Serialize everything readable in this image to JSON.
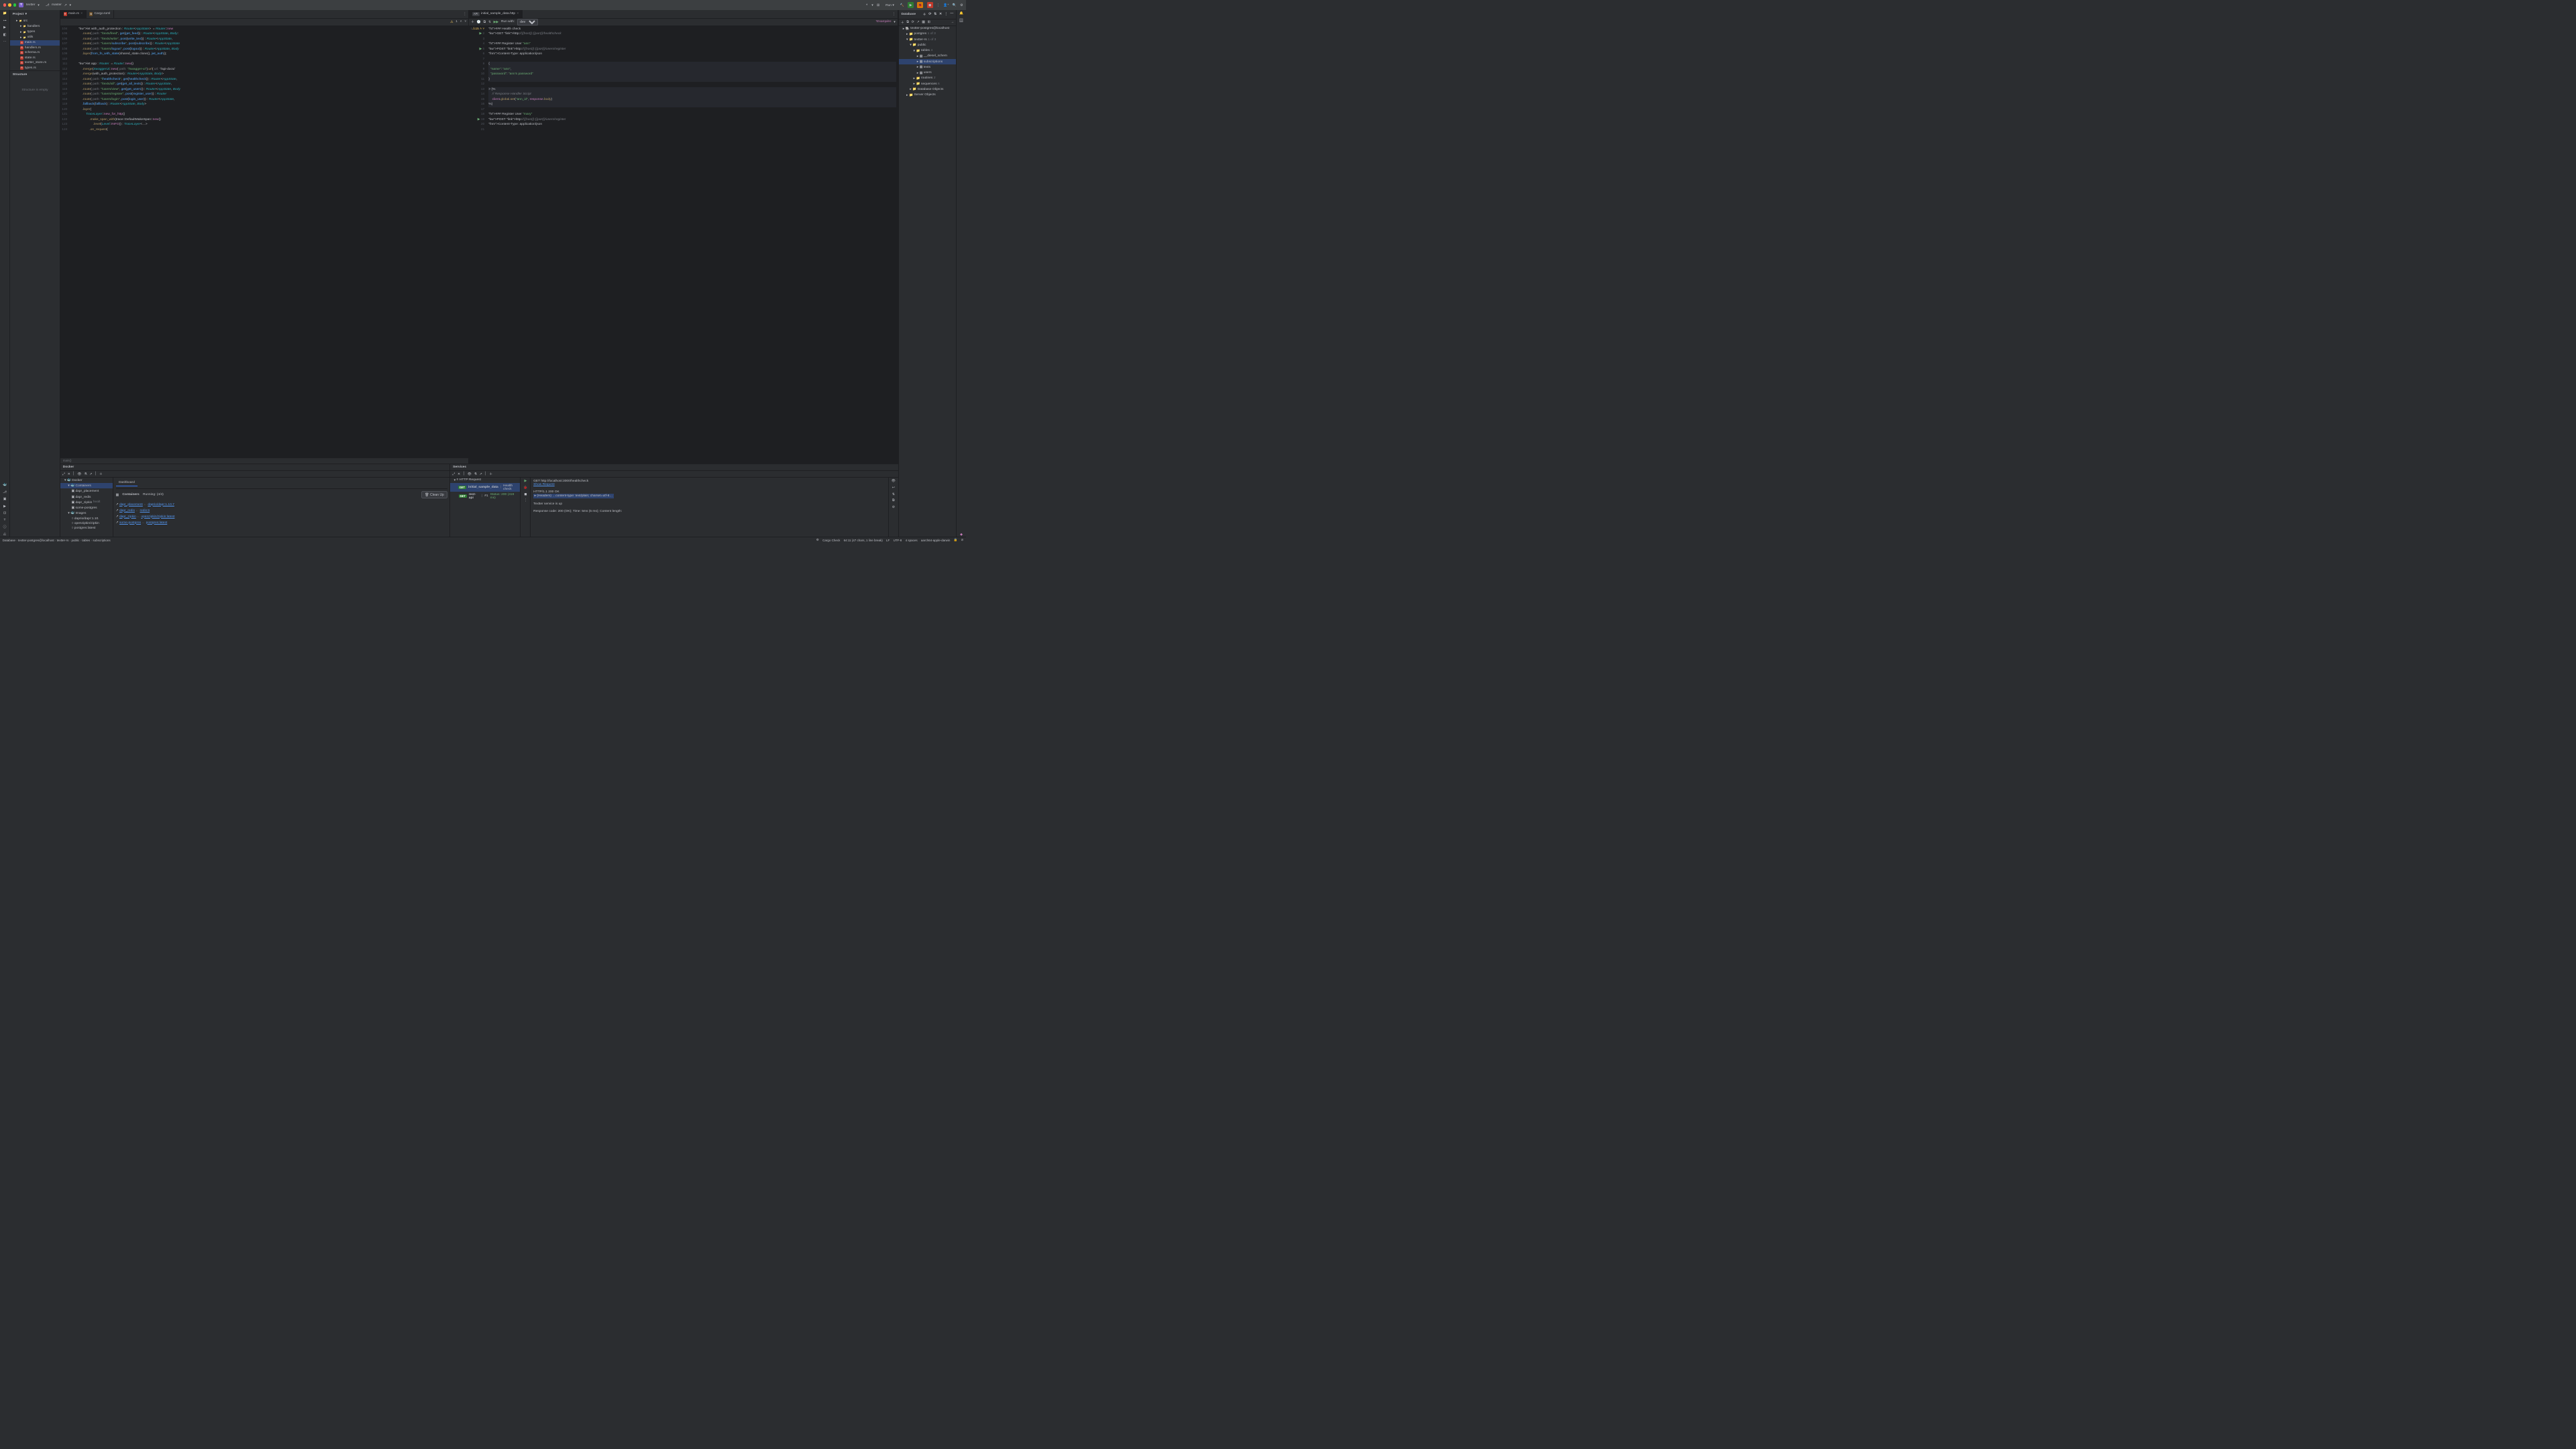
{
  "titlebar": {
    "project_badge": "T",
    "project_name": "textter",
    "branch": "master",
    "run_label": "Run"
  },
  "project_panel": {
    "title": "Project",
    "items": [
      {
        "label": "src",
        "icon": "dir",
        "indent": 0,
        "expanded": true
      },
      {
        "label": "handlers",
        "icon": "dir",
        "indent": 1
      },
      {
        "label": "types",
        "icon": "dir",
        "indent": 1
      },
      {
        "label": "utils",
        "icon": "dir",
        "indent": 1
      },
      {
        "label": "main.rs",
        "icon": "rs",
        "indent": 1,
        "selected": true
      },
      {
        "label": "handlers.rs",
        "icon": "rs",
        "indent": 1
      },
      {
        "label": "schema.rs",
        "icon": "rs",
        "indent": 1
      },
      {
        "label": "state.rs",
        "icon": "rs",
        "indent": 1
      },
      {
        "label": "textter_store.rs",
        "icon": "rs",
        "indent": 1
      },
      {
        "label": "types.rs",
        "icon": "rs",
        "indent": 1
      }
    ]
  },
  "structure_panel": {
    "title": "Structure",
    "empty": "Structure is empty"
  },
  "editor_left": {
    "tabs": [
      {
        "label": "main.rs",
        "icon": "rs",
        "active": true
      },
      {
        "label": "Cargo.toml",
        "icon": "toml"
      }
    ],
    "gutter_start": 104,
    "gutter_end": 124,
    "inline_warn": "1",
    "lines": [
      {
        "t": "        let with_auth_protection : Router<AppState>  = Router::new"
      },
      {
        "t": "            .route( path: \"/texts/feed\", get(get_feed)) : Router<AppState, Body:"
      },
      {
        "t": "            .route( path: \"/texts/write\", post(write_text)) : Router<AppState,"
      },
      {
        "t": "            .route( path: \"/users/subscribe\", post(subscribe)) : Router<AppState"
      },
      {
        "t": "            .route( path: \"/users/logout\", post(logout)) : Router<AppState, Body"
      },
      {
        "t": "            .layer(from_fn_with_state(shared_state.clone(), jwt_auth));"
      },
      {
        "t": ""
      },
      {
        "t": "        let app : Router  = Router::new()"
      },
      {
        "t": "            .merge(SwaggerUi::new( path: \"/swagger-ui\").url( url: \"/api-docs/"
      },
      {
        "t": "            .merge(with_auth_protection) : Router<AppState, Body>"
      },
      {
        "t": "            .route( path: \"/healthcheck\", get(healthcheck)) : Router<AppState,"
      },
      {
        "t": "            .route( path: \"/texts/all\", get(get_all_texts)) : Router<AppState,"
      },
      {
        "t": "            .route( path: \"/users/view\", get(get_users)) : Router<AppState, Body"
      },
      {
        "t": "            .route( path: \"/users/register\", post(register_user)) : Router<Ap"
      },
      {
        "t": "            .route( path: \"/users/login\", post(login_user)) : Router<AppState,"
      },
      {
        "t": "            .fallback(fallback) : Router<AppState, Body>"
      },
      {
        "t": "            .layer("
      },
      {
        "t": "                TraceLayer::new_for_http()"
      },
      {
        "t": "                    .make_span_with(trace::DefaultMakeSpan::new()"
      },
      {
        "t": "                        .level(Level::INFO)) : TraceLayer<…>"
      },
      {
        "t": "                    .on_request("
      }
    ],
    "breadcrumb": "main()"
  },
  "editor_right": {
    "tab": {
      "label": "initial_sample_data.http",
      "icon": "api"
    },
    "run_with": "Run with:",
    "env": "dev",
    "examples": "*Examples",
    "warn_count": "15",
    "gutter_start": 1,
    "gutter_end": 21,
    "lines": [
      "### Health check",
      "GET http://{{host}}:{{port}}/healthcheck",
      "",
      "### Register User \"ann\"",
      "POST http://{{host}}:{{port}}/users/register",
      "Content-Type: application/json",
      "",
      "{",
      "  \"name\": \"ann\",",
      "  \"password\": \"ann's password\"",
      "}",
      "",
      "> {%",
      "    // Response Handler Script",
      "    client.global.set(\"ann_id\", response.body)",
      "%}",
      "",
      "### Register User \"mary\"",
      "POST http://{{host}}:{{port}}/users/register",
      "Content-Type: application/json",
      ""
    ]
  },
  "database_panel": {
    "title": "Database",
    "items": [
      {
        "label": "textter-postgres@localhost",
        "indent": 0,
        "icon": "pg"
      },
      {
        "label": "postgres",
        "indent": 1,
        "suffix": "1 of 3"
      },
      {
        "label": "textter-rs",
        "indent": 1,
        "suffix": "1 of 3",
        "expanded": true
      },
      {
        "label": "public",
        "indent": 2,
        "expanded": true
      },
      {
        "label": "tables",
        "indent": 3,
        "suffix": "4",
        "expanded": true
      },
      {
        "label": "__diesel_schem",
        "indent": 4,
        "icon": "table"
      },
      {
        "label": "subscriptions",
        "indent": 4,
        "icon": "table",
        "selected": true
      },
      {
        "label": "texts",
        "indent": 4,
        "icon": "table"
      },
      {
        "label": "users",
        "indent": 4,
        "icon": "table"
      },
      {
        "label": "routines",
        "indent": 3,
        "suffix": "2"
      },
      {
        "label": "sequences",
        "indent": 3,
        "suffix": "6"
      },
      {
        "label": "Database Objects",
        "indent": 2
      },
      {
        "label": "Server Objects",
        "indent": 1
      }
    ]
  },
  "docker_panel": {
    "title": "Docker",
    "dash_tab": "Dashboard",
    "containers_hdr": "Containers",
    "running": "Running: (4/4)",
    "clean": "Clean Up",
    "tree": [
      {
        "label": "Docker",
        "indent": 0,
        "expanded": true
      },
      {
        "label": "Containers",
        "indent": 1,
        "expanded": true,
        "selected": true
      },
      {
        "label": "dapr_placement",
        "indent": 2
      },
      {
        "label": "dapr_redis",
        "indent": 2
      },
      {
        "label": "dapr_zipkin",
        "indent": 2,
        "status": "healt"
      },
      {
        "label": "some-postgres",
        "indent": 2
      },
      {
        "label": "Images",
        "indent": 1,
        "expanded": true
      },
      {
        "label": "daprio/dapr:1.10.",
        "indent": 2,
        "icon": "img"
      },
      {
        "label": "openzipkin/zipkin",
        "indent": 2,
        "icon": "img"
      },
      {
        "label": "postgres:latest",
        "indent": 2,
        "icon": "img"
      }
    ],
    "list": [
      {
        "name": "dapr_placement",
        "image": "daprio/dapr:1.10.7"
      },
      {
        "name": "dapr_redis",
        "image": "redis:6"
      },
      {
        "name": "dapr_zipkin",
        "image": "openzipkin/zipkin:latest"
      },
      {
        "name": "some-postgres",
        "image": "postgres:latest"
      }
    ]
  },
  "services_panel": {
    "title": "Services",
    "http_req": "HTTP Request",
    "rows": [
      {
        "tag": "GET",
        "name": "initial_sample_data",
        "sub": "Health check",
        "selected": true
      },
      {
        "tag": "GET",
        "name": "rest-api",
        "sub": "#1",
        "status": "Status: 200 (419 ms)"
      }
    ],
    "response": {
      "req_line": "GET http://localhost:3000/healthcheck",
      "show_req": "Show Request",
      "status_line": "HTTP/1.1 200 OK",
      "headers_line": "(Headers) …content-type: text/plain; charset=utf-8…",
      "body": "Textter service is up",
      "footer": "Response code: 200 (OK); Time: 5ms (5 ms); Content length: "
    }
  },
  "statusbar": {
    "crumbs": [
      "Database",
      "textter-postgres@localhost",
      "textter-rs",
      "public",
      "tables",
      "subscriptions"
    ],
    "cargo": "Cargo Check",
    "pos": "64:11 (47 chars, 1 line break)",
    "eol": "LF",
    "enc": "UTF-8",
    "indent": "4 spaces",
    "arch": "aarch64-apple-darwin"
  }
}
